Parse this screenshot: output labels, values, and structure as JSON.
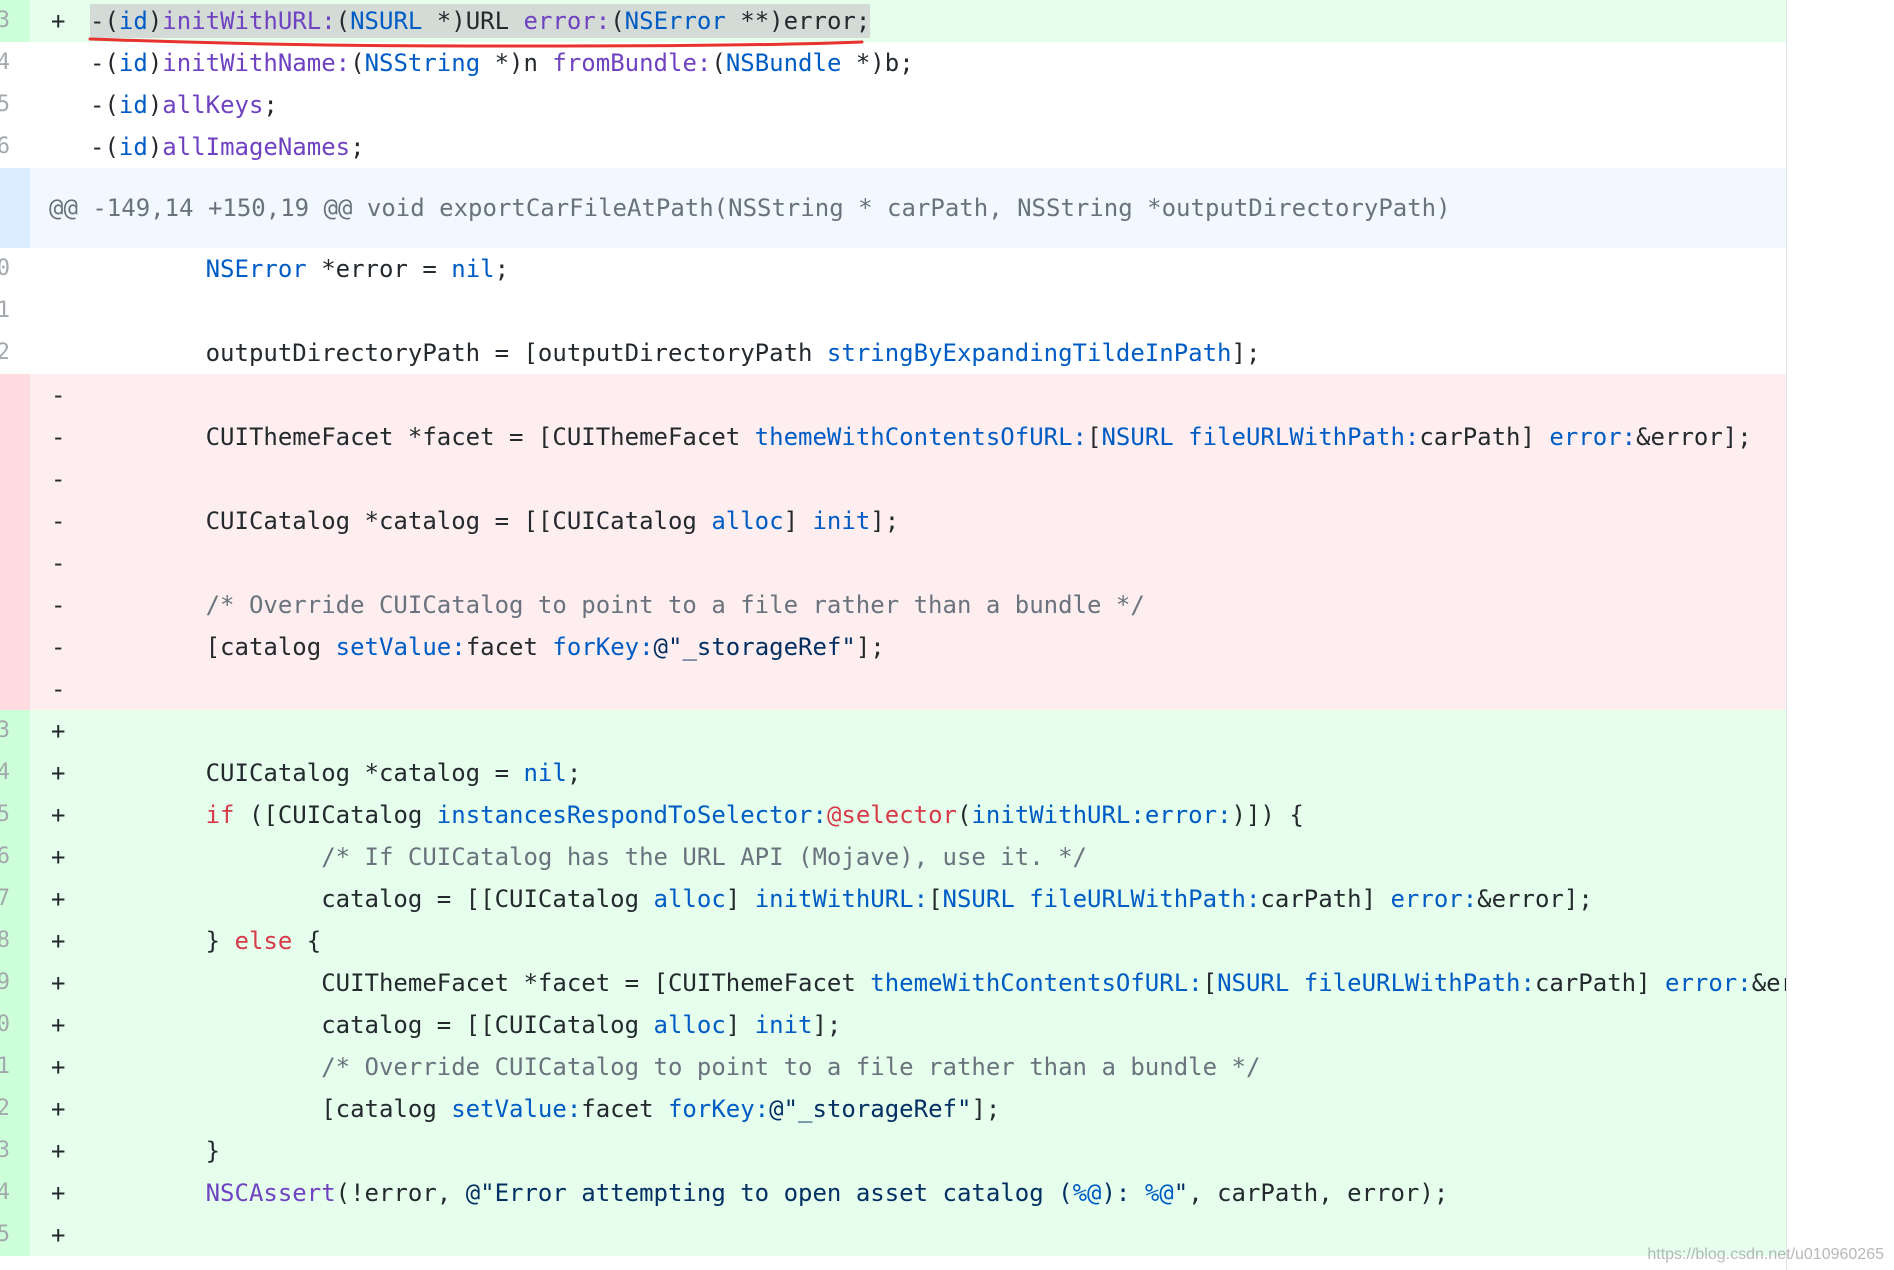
{
  "theme": {
    "added_bg": "#e6ffed",
    "added_num_bg": "#cdffd8",
    "deleted_bg": "#ffeef0",
    "deleted_num_bg": "#ffdce0",
    "hunk_bg": "#f1f8ff",
    "hunk_num_bg": "#dbedff",
    "selection_bg": "#d4dad6",
    "annotation_color": "#e8322f"
  },
  "diff": {
    "top_rows": [
      {
        "n": "3",
        "m": "+",
        "code": [
          {
            "t": "-("
          },
          {
            "t": "id",
            "color": "#005cc5"
          },
          {
            "t": ")"
          },
          {
            "t": "initWithURL:",
            "color": "#6f42c1"
          },
          {
            "t": "("
          },
          {
            "t": "NSURL",
            "color": "#005cc5"
          },
          {
            "t": " *)URL "
          },
          {
            "t": "error:",
            "color": "#6f42c1"
          },
          {
            "t": "("
          },
          {
            "t": "NSError",
            "color": "#005cc5"
          },
          {
            "t": " **)error;"
          }
        ]
      },
      {
        "n": "4",
        "code": [
          {
            "t": "-("
          },
          {
            "t": "id",
            "color": "#005cc5"
          },
          {
            "t": ")"
          },
          {
            "t": "initWithName:",
            "color": "#6f42c1"
          },
          {
            "t": "("
          },
          {
            "t": "NSString",
            "color": "#005cc5"
          },
          {
            "t": " *)n "
          },
          {
            "t": "fromBundle:",
            "color": "#6f42c1"
          },
          {
            "t": "("
          },
          {
            "t": "NSBundle",
            "color": "#005cc5"
          },
          {
            "t": " *)b;"
          }
        ]
      },
      {
        "n": "5",
        "code": [
          {
            "t": "-("
          },
          {
            "t": "id",
            "color": "#005cc5"
          },
          {
            "t": ")"
          },
          {
            "t": "allKeys",
            "color": "#6f42c1"
          },
          {
            "t": ";"
          }
        ]
      },
      {
        "n": "6",
        "code": [
          {
            "t": "-("
          },
          {
            "t": "id",
            "color": "#005cc5"
          },
          {
            "t": ")"
          },
          {
            "t": "allImageNames",
            "color": "#6f42c1"
          },
          {
            "t": ";"
          }
        ]
      }
    ],
    "hunk_header": "@@ -149,14 +150,19 @@ void exportCarFileAtPath(NSString * carPath, NSString *outputDirectoryPath)",
    "hunk_rows": [
      {
        "n": "0",
        "code": [
          {
            "t": "\tNSError",
            "color": "#005cc5"
          },
          {
            "t": " *error = "
          },
          {
            "t": "nil",
            "color": "#005cc5"
          },
          {
            "t": ";"
          }
        ]
      },
      {
        "n": "1",
        "code": []
      },
      {
        "n": "2",
        "code": [
          {
            "t": "\toutputDirectoryPath = [outputDirectoryPath "
          },
          {
            "t": "stringByExpandingTildeInPath",
            "color": "#005cc5"
          },
          {
            "t": "];"
          }
        ]
      },
      {
        "m": "-",
        "code": []
      },
      {
        "m": "-",
        "code": [
          {
            "t": "\tCUIThemeFacet *facet = [CUIThemeFacet "
          },
          {
            "t": "themeWithContentsOfURL:",
            "color": "#005cc5"
          },
          {
            "t": "["
          },
          {
            "t": "NSURL ",
            "color": "#005cc5"
          },
          {
            "t": "fileURLWithPath:",
            "color": "#005cc5"
          },
          {
            "t": "carPath] "
          },
          {
            "t": "error:",
            "color": "#005cc5"
          },
          {
            "t": "&error];"
          }
        ]
      },
      {
        "m": "-",
        "code": []
      },
      {
        "m": "-",
        "code": [
          {
            "t": "\tCUICatalog *catalog = [[CUICatalog "
          },
          {
            "t": "alloc",
            "color": "#005cc5"
          },
          {
            "t": "] "
          },
          {
            "t": "init",
            "color": "#005cc5"
          },
          {
            "t": "];"
          }
        ]
      },
      {
        "m": "-",
        "code": []
      },
      {
        "m": "-",
        "code": [
          {
            "t": "\t/* Override CUICatalog to point to a file rather than a bundle */",
            "color": "#6a737d"
          }
        ]
      },
      {
        "m": "-",
        "code": [
          {
            "t": "\t[catalog "
          },
          {
            "t": "setValue:",
            "color": "#005cc5"
          },
          {
            "t": "facet "
          },
          {
            "t": "forKey:",
            "color": "#005cc5"
          },
          {
            "t": "@\"_storageRef\"",
            "color": "#032f62"
          },
          {
            "t": "];"
          }
        ]
      },
      {
        "m": "-",
        "code": []
      },
      {
        "n": "3",
        "m": "+",
        "code": []
      },
      {
        "n": "4",
        "m": "+",
        "code": [
          {
            "t": "\tCUICatalog *catalog = "
          },
          {
            "t": "nil",
            "color": "#005cc5"
          },
          {
            "t": ";"
          }
        ]
      },
      {
        "n": "5",
        "m": "+",
        "code": [
          {
            "t": "\tif",
            "color": "#d73a49"
          },
          {
            "t": " ([CUICatalog "
          },
          {
            "t": "instancesRespondToSelector:",
            "color": "#005cc5"
          },
          {
            "t": "@selector",
            "color": "#d73a49"
          },
          {
            "t": "("
          },
          {
            "t": "initWithURL:error:",
            "color": "#005cc5"
          },
          {
            "t": ")]) {"
          }
        ]
      },
      {
        "n": "6",
        "m": "+",
        "code": [
          {
            "t": "\t\t/* If CUICatalog has the URL API (Mojave), use it. */",
            "color": "#6a737d"
          }
        ]
      },
      {
        "n": "7",
        "m": "+",
        "code": [
          {
            "t": "\t\tcatalog = [[CUICatalog "
          },
          {
            "t": "alloc",
            "color": "#005cc5"
          },
          {
            "t": "] "
          },
          {
            "t": "initWithURL:",
            "color": "#005cc5"
          },
          {
            "t": "["
          },
          {
            "t": "NSURL ",
            "color": "#005cc5"
          },
          {
            "t": "fileURLWithPath:",
            "color": "#005cc5"
          },
          {
            "t": "carPath] "
          },
          {
            "t": "error:",
            "color": "#005cc5"
          },
          {
            "t": "&error];"
          }
        ]
      },
      {
        "n": "8",
        "m": "+",
        "code": [
          {
            "t": "\t} "
          },
          {
            "t": "else",
            "color": "#d73a49"
          },
          {
            "t": " {"
          }
        ]
      },
      {
        "n": "9",
        "m": "+",
        "code": [
          {
            "t": "\t\tCUIThemeFacet *facet = [CUIThemeFacet "
          },
          {
            "t": "themeWithContentsOfURL:",
            "color": "#005cc5"
          },
          {
            "t": "["
          },
          {
            "t": "NSURL ",
            "color": "#005cc5"
          },
          {
            "t": "fileURLWithPath:",
            "color": "#005cc5"
          },
          {
            "t": "carPath] "
          },
          {
            "t": "error:",
            "color": "#005cc5"
          },
          {
            "t": "&er"
          }
        ]
      },
      {
        "n": "0",
        "m": "+",
        "code": [
          {
            "t": "\t\tcatalog = [[CUICatalog "
          },
          {
            "t": "alloc",
            "color": "#005cc5"
          },
          {
            "t": "] "
          },
          {
            "t": "init",
            "color": "#005cc5"
          },
          {
            "t": "];"
          }
        ]
      },
      {
        "n": "1",
        "m": "+",
        "code": [
          {
            "t": "\t\t/* Override CUICatalog to point to a file rather than a bundle */",
            "color": "#6a737d"
          }
        ]
      },
      {
        "n": "2",
        "m": "+",
        "code": [
          {
            "t": "\t\t[catalog "
          },
          {
            "t": "setValue:",
            "color": "#005cc5"
          },
          {
            "t": "facet "
          },
          {
            "t": "forKey:",
            "color": "#005cc5"
          },
          {
            "t": "@\"_storageRef\"",
            "color": "#032f62"
          },
          {
            "t": "];"
          }
        ]
      },
      {
        "n": "3",
        "m": "+",
        "code": [
          {
            "t": "\t}"
          }
        ]
      },
      {
        "n": "4",
        "m": "+",
        "code": [
          {
            "t": "\tNSCAssert",
            "color": "#6f42c1"
          },
          {
            "t": "(!error, "
          },
          {
            "t": "@\"Error attempting to open asset catalog (",
            "color": "#032f62"
          },
          {
            "t": "%@",
            "color": "#005cc5"
          },
          {
            "t": "): ",
            "color": "#032f62"
          },
          {
            "t": "%@",
            "color": "#005cc5"
          },
          {
            "t": "\"",
            "color": "#032f62"
          },
          {
            "t": ", carPath, error);"
          }
        ]
      },
      {
        "n": "5",
        "m": "+",
        "code": []
      },
      {
        "code": []
      }
    ]
  },
  "watermark": "https://blog.csdn.net/u010960265"
}
